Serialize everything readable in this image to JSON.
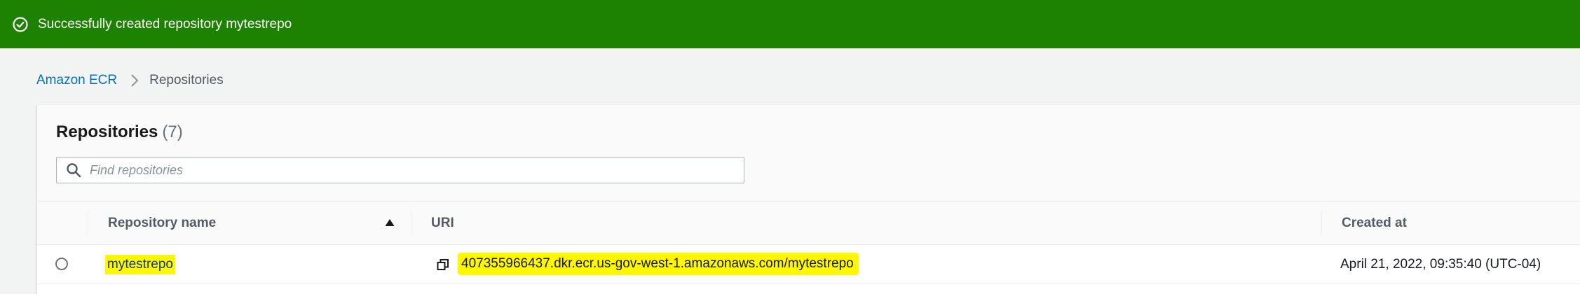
{
  "flash": {
    "message": "Successfully created repository mytestrepo",
    "icon": "check-circle-icon",
    "color": "#1d8102"
  },
  "breadcrumb": {
    "root": "Amazon ECR",
    "separator_icon": "chevron-right-icon",
    "current": "Repositories"
  },
  "repositories": {
    "title": "Repositories",
    "count": "(7)",
    "search": {
      "placeholder": "Find repositories",
      "value": "",
      "icon": "search-icon"
    },
    "columns": {
      "name": "Repository name",
      "uri": "URI",
      "created": "Created at"
    },
    "sort": {
      "column": "Repository name",
      "direction": "ascending",
      "icon": "sort-up-icon"
    },
    "rows": [
      {
        "name": "mytestrepo",
        "uri": "407355966437.dkr.ecr.us-gov-west-1.amazonaws.com/mytestrepo",
        "created": "April 21, 2022, 09:35:40 (UTC-04)",
        "copy_icon": "copy-icon",
        "selected": false
      }
    ]
  },
  "colors": {
    "link": "#0073bb",
    "highlight": "#fff700",
    "background": "#f2f3f3"
  }
}
